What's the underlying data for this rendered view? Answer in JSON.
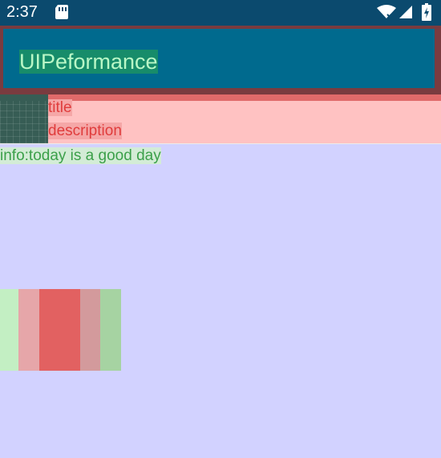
{
  "status_bar": {
    "time": "2:37",
    "icons": [
      "sd-card-icon",
      "wifi-icon",
      "signal-icon",
      "battery-icon"
    ]
  },
  "app_bar": {
    "title": "UIPeformance"
  },
  "list_item": {
    "title": "title",
    "description": "description"
  },
  "info": {
    "text": "info:today is a good day"
  },
  "colors": {
    "status_bar": "#0b4a6e",
    "app_bar": "#006a8e",
    "overdraw_red": "#e26161",
    "overdraw_pink": "#ffc2c2",
    "overdraw_green": "#c3efc3",
    "overdraw_blue": "#d2d2ff"
  }
}
